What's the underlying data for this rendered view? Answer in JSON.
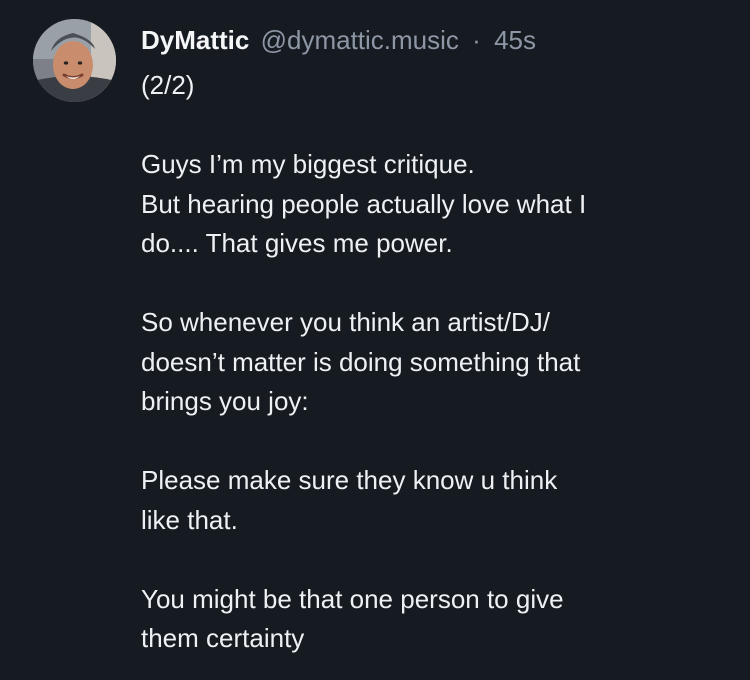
{
  "post": {
    "author": {
      "display_name": "DyMattic",
      "handle": "@dymattic.music",
      "avatar_icon": "profile-photo"
    },
    "separator": "·",
    "timestamp": "45s",
    "text_paragraphs": [
      [
        "(2/2)"
      ],
      [
        "Guys I’m my biggest critique.",
        "But hearing people actually love what I",
        "do.... That gives me power."
      ],
      [
        "So whenever you think an artist/DJ/",
        "doesn’t matter is doing something that",
        "brings you joy:"
      ],
      [
        "Please make sure they know u think",
        "like that."
      ],
      [
        "You might be that one person to give",
        "them certainty"
      ]
    ]
  },
  "colors": {
    "background": "#161a21",
    "text": "#eef1f4",
    "muted": "#8d97a5"
  }
}
